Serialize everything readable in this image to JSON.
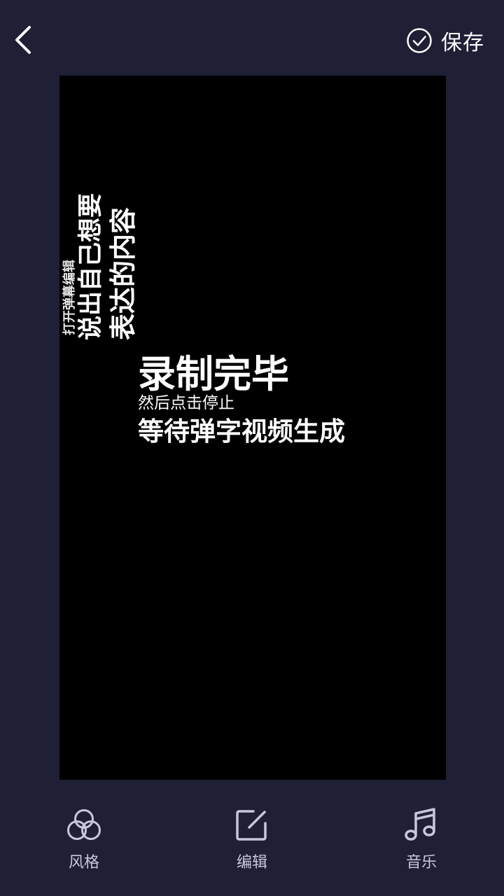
{
  "header": {
    "back_icon": "chevron-left-icon",
    "save_icon": "check-circle-icon",
    "save_label": "保存"
  },
  "preview": {
    "vertical_small": "打开弹幕编辑",
    "vertical_mid": "说出自己想要",
    "vertical_big": "表达的内容",
    "line1": "录制完毕",
    "line2": "然后点击停止",
    "line3": "等待弹字视频生成"
  },
  "toolbar": {
    "style_icon": "circles-icon",
    "style_label": "风格",
    "edit_icon": "edit-icon",
    "edit_label": "编辑",
    "music_icon": "music-note-icon",
    "music_label": "音乐"
  },
  "colors": {
    "background": "#1f1f35",
    "preview": "#000000",
    "icon": "#c7c7e0",
    "text": "#ffffff"
  }
}
